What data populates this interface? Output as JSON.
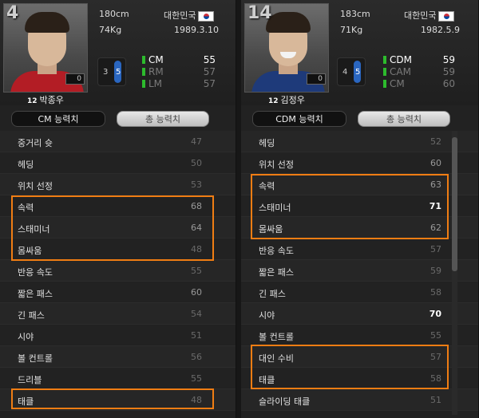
{
  "left": {
    "number": "4",
    "height": "180cm",
    "weight": "74Kg",
    "country": "대한민국",
    "birth": "1989.3.10",
    "overall_small": "0",
    "shirt_no": "12",
    "name": "박종우",
    "foot_left": "3",
    "foot_right": "5",
    "positions": [
      {
        "label": "CM",
        "value": "55",
        "color": "#2dbb2d",
        "main": true
      },
      {
        "label": "RM",
        "value": "57",
        "color": "#2dbb2d",
        "main": false
      },
      {
        "label": "LM",
        "value": "57",
        "color": "#2dbb2d",
        "main": false
      }
    ],
    "tab_active": "CM 능력치",
    "tab_inactive": "총 능력치",
    "stats": [
      {
        "name": "중거리 슛",
        "value": "47"
      },
      {
        "name": "헤딩",
        "value": "50"
      },
      {
        "name": "위치 선정",
        "value": "53"
      },
      {
        "name": "속력",
        "value": "68"
      },
      {
        "name": "스태미너",
        "value": "64"
      },
      {
        "name": "몸싸움",
        "value": "48"
      },
      {
        "name": "반응 속도",
        "value": "55"
      },
      {
        "name": "짧은 패스",
        "value": "60"
      },
      {
        "name": "긴 패스",
        "value": "54"
      },
      {
        "name": "시야",
        "value": "51"
      },
      {
        "name": "볼 컨트롤",
        "value": "56"
      },
      {
        "name": "드리블",
        "value": "55"
      },
      {
        "name": "태클",
        "value": "48"
      }
    ]
  },
  "right": {
    "number": "14",
    "height": "183cm",
    "weight": "71Kg",
    "country": "대한민국",
    "birth": "1982.5.9",
    "overall_small": "0",
    "shirt_no": "12",
    "name": "김정우",
    "foot_left": "4",
    "foot_right": "5",
    "positions": [
      {
        "label": "CDM",
        "value": "59",
        "color": "#2dbb2d",
        "main": true
      },
      {
        "label": "CAM",
        "value": "59",
        "color": "#2dbb2d",
        "main": false
      },
      {
        "label": "CM",
        "value": "60",
        "color": "#2dbb2d",
        "main": false
      }
    ],
    "tab_active": "CDM 능력치",
    "tab_inactive": "총 능력치",
    "stats": [
      {
        "name": "헤딩",
        "value": "52"
      },
      {
        "name": "위치 선정",
        "value": "60"
      },
      {
        "name": "속력",
        "value": "63"
      },
      {
        "name": "스태미너",
        "value": "71"
      },
      {
        "name": "몸싸움",
        "value": "62"
      },
      {
        "name": "반응 속도",
        "value": "57"
      },
      {
        "name": "짧은 패스",
        "value": "59"
      },
      {
        "name": "긴 패스",
        "value": "58"
      },
      {
        "name": "시야",
        "value": "70"
      },
      {
        "name": "볼 컨트롤",
        "value": "55"
      },
      {
        "name": "대인 수비",
        "value": "57"
      },
      {
        "name": "태클",
        "value": "58"
      },
      {
        "name": "슬라이딩 태클",
        "value": "51"
      }
    ]
  },
  "colors": {
    "highlight": "#f07d13",
    "position_bar": "#2dbb2d",
    "foot_blue": "#3a7bd5"
  }
}
